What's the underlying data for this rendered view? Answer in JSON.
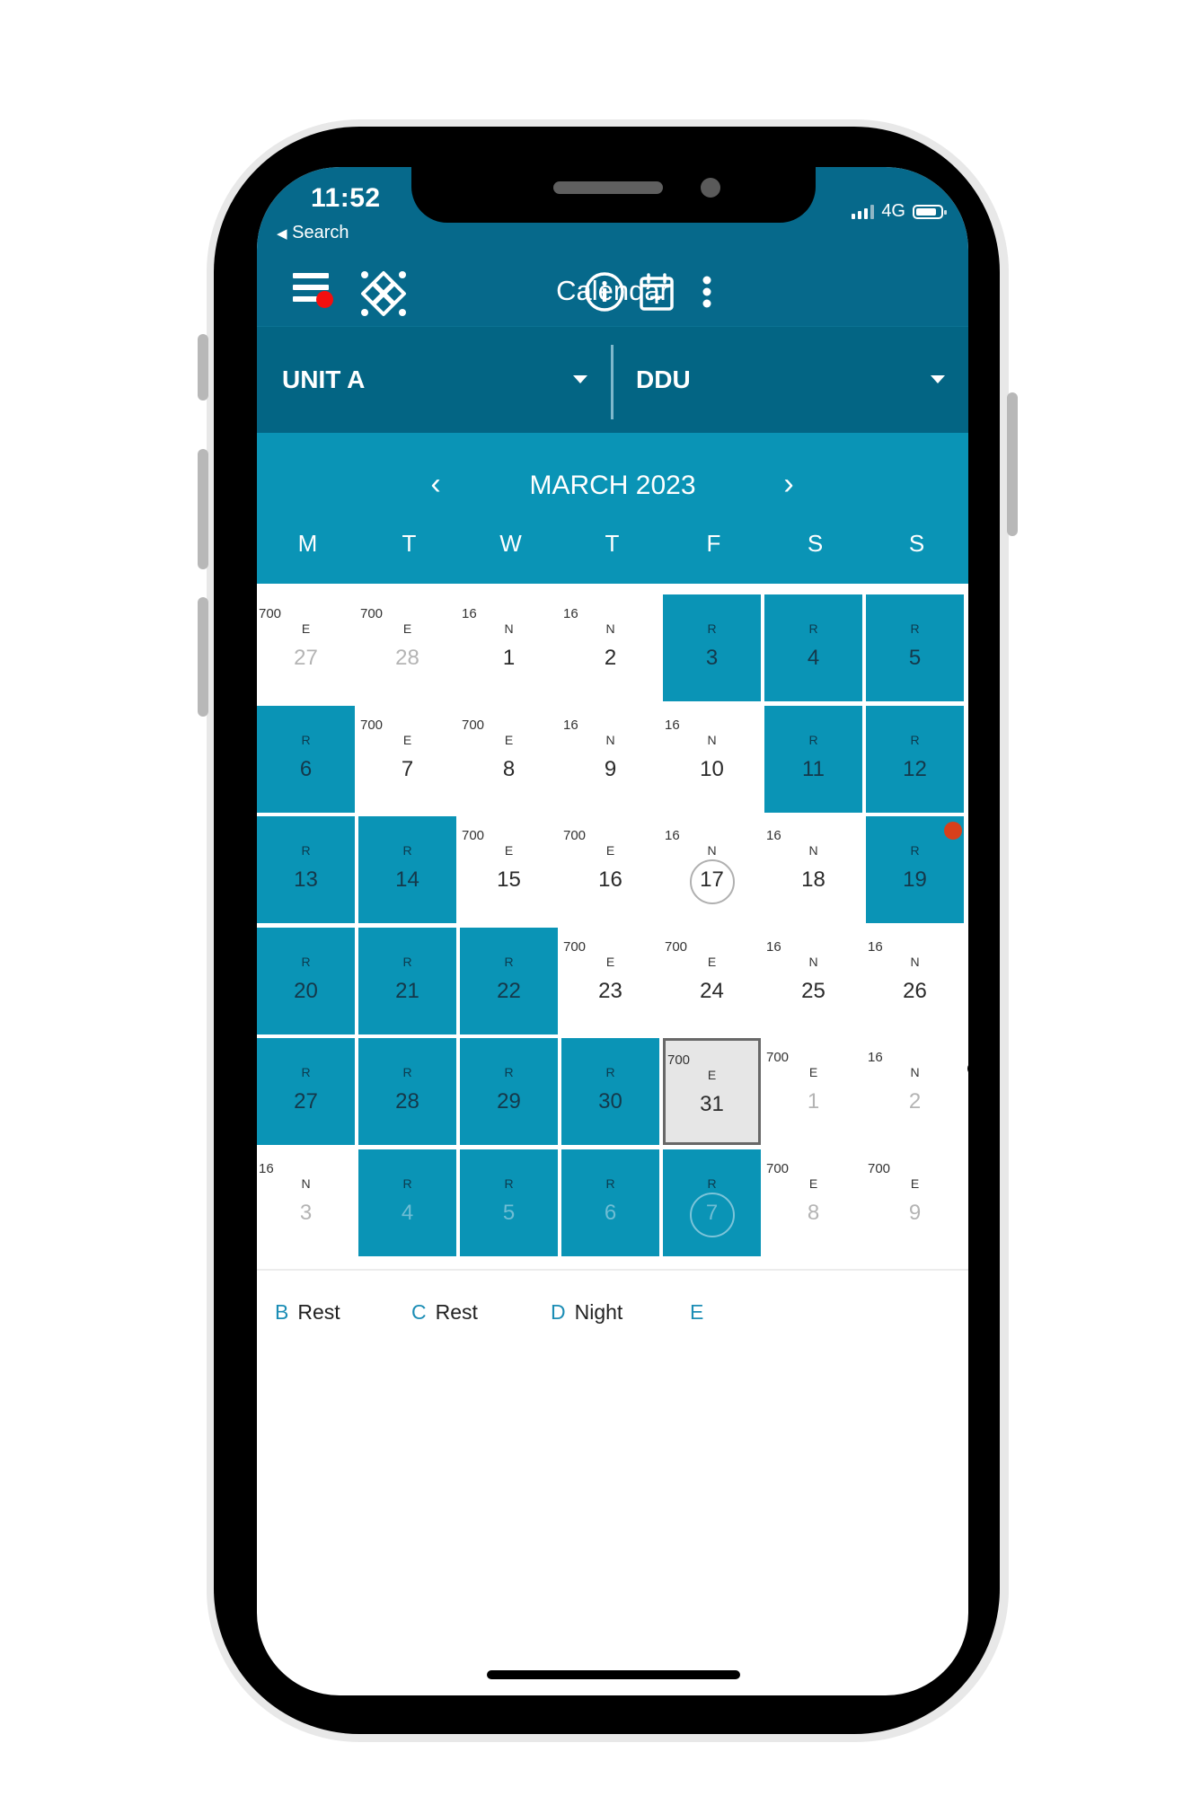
{
  "status_bar": {
    "time": "11:52",
    "back_label": "Search",
    "network": "4G",
    "signal_bars": 3,
    "signal_max": 4,
    "battery_level": 0.85
  },
  "app_bar": {
    "title": "Calendar",
    "icons": [
      "menu-icon",
      "logo-icon",
      "info-icon",
      "calendar-add-icon",
      "more-vertical-icon"
    ],
    "menu_notification": true
  },
  "selectors": {
    "unit": "UNIT A",
    "group": "DDU"
  },
  "calendar": {
    "month_label": "MARCH 2023",
    "prev_label": "‹",
    "next_label": "›",
    "weekdays": [
      "M",
      "T",
      "W",
      "T",
      "F",
      "S",
      "S"
    ],
    "colors": {
      "rest": "#0a94b6",
      "header": "#06698b",
      "selector_band": "#036584",
      "selected_bg": "#e6e6e6"
    },
    "weeks": [
      [
        {
          "day": "27",
          "hours": "700",
          "code": "E",
          "type": "work",
          "other_month": true
        },
        {
          "day": "28",
          "hours": "700",
          "code": "E",
          "type": "work",
          "other_month": true
        },
        {
          "day": "1",
          "hours": "16",
          "code": "N",
          "type": "work"
        },
        {
          "day": "2",
          "hours": "16",
          "code": "N",
          "type": "work"
        },
        {
          "day": "3",
          "hours": "",
          "code": "R",
          "type": "rest"
        },
        {
          "day": "4",
          "hours": "",
          "code": "R",
          "type": "rest"
        },
        {
          "day": "5",
          "hours": "",
          "code": "R",
          "type": "rest"
        }
      ],
      [
        {
          "day": "6",
          "hours": "",
          "code": "R",
          "type": "rest"
        },
        {
          "day": "7",
          "hours": "700",
          "code": "E",
          "type": "work"
        },
        {
          "day": "8",
          "hours": "700",
          "code": "E",
          "type": "work"
        },
        {
          "day": "9",
          "hours": "16",
          "code": "N",
          "type": "work"
        },
        {
          "day": "10",
          "hours": "16",
          "code": "N",
          "type": "work"
        },
        {
          "day": "11",
          "hours": "",
          "code": "R",
          "type": "rest"
        },
        {
          "day": "12",
          "hours": "",
          "code": "R",
          "type": "rest"
        }
      ],
      [
        {
          "day": "13",
          "hours": "",
          "code": "R",
          "type": "rest"
        },
        {
          "day": "14",
          "hours": "",
          "code": "R",
          "type": "rest"
        },
        {
          "day": "15",
          "hours": "700",
          "code": "E",
          "type": "work"
        },
        {
          "day": "16",
          "hours": "700",
          "code": "E",
          "type": "work"
        },
        {
          "day": "17",
          "hours": "16",
          "code": "N",
          "type": "work",
          "circled": true
        },
        {
          "day": "18",
          "hours": "16",
          "code": "N",
          "type": "work"
        },
        {
          "day": "19",
          "hours": "",
          "code": "R",
          "type": "rest",
          "red_dot": true
        }
      ],
      [
        {
          "day": "20",
          "hours": "",
          "code": "R",
          "type": "rest"
        },
        {
          "day": "21",
          "hours": "",
          "code": "R",
          "type": "rest"
        },
        {
          "day": "22",
          "hours": "",
          "code": "R",
          "type": "rest"
        },
        {
          "day": "23",
          "hours": "700",
          "code": "E",
          "type": "work"
        },
        {
          "day": "24",
          "hours": "700",
          "code": "E",
          "type": "work"
        },
        {
          "day": "25",
          "hours": "16",
          "code": "N",
          "type": "work"
        },
        {
          "day": "26",
          "hours": "16",
          "code": "N",
          "type": "work"
        }
      ],
      [
        {
          "day": "27",
          "hours": "",
          "code": "R",
          "type": "rest"
        },
        {
          "day": "28",
          "hours": "",
          "code": "R",
          "type": "rest"
        },
        {
          "day": "29",
          "hours": "",
          "code": "R",
          "type": "rest"
        },
        {
          "day": "30",
          "hours": "",
          "code": "R",
          "type": "rest"
        },
        {
          "day": "31",
          "hours": "700",
          "code": "E",
          "type": "work",
          "selected": true
        },
        {
          "day": "1",
          "hours": "700",
          "code": "E",
          "type": "work",
          "other_month": true
        },
        {
          "day": "2",
          "hours": "16",
          "code": "N",
          "type": "work",
          "other_month": true,
          "black_dot": true
        }
      ],
      [
        {
          "day": "3",
          "hours": "16",
          "code": "N",
          "type": "work",
          "other_month": true
        },
        {
          "day": "4",
          "hours": "",
          "code": "R",
          "type": "rest",
          "other_month": true
        },
        {
          "day": "5",
          "hours": "",
          "code": "R",
          "type": "rest",
          "other_month": true
        },
        {
          "day": "6",
          "hours": "",
          "code": "R",
          "type": "rest",
          "other_month": true
        },
        {
          "day": "7",
          "hours": "",
          "code": "R",
          "type": "rest",
          "other_month": true,
          "circled": true
        },
        {
          "day": "8",
          "hours": "700",
          "code": "E",
          "type": "work",
          "other_month": true
        },
        {
          "day": "9",
          "hours": "700",
          "code": "E",
          "type": "work",
          "other_month": true
        }
      ]
    ]
  },
  "legend": [
    {
      "key": "B",
      "label": "Rest"
    },
    {
      "key": "C",
      "label": "Rest"
    },
    {
      "key": "D",
      "label": "Night"
    },
    {
      "key": "E",
      "label": ""
    }
  ]
}
